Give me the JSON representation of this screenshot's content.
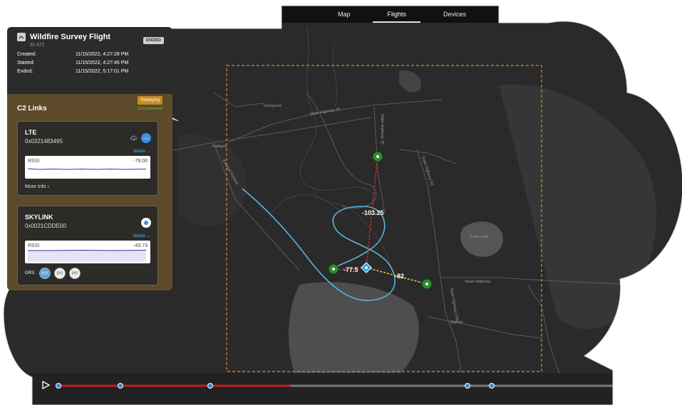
{
  "nav": {
    "tabs": [
      {
        "label": "Map"
      },
      {
        "label": "Flights",
        "active": true
      },
      {
        "label": "Devices"
      }
    ]
  },
  "flight": {
    "title": "Wildfire Survey Flight",
    "id_label": "ID 472",
    "status": "ENDED",
    "created_label": "Created:",
    "created": "11/15/2022, 4:27:28 PM",
    "started_label": "Started:",
    "started": "11/15/2022, 4:27:46 PM",
    "ended_label": "Ended:",
    "ended": "11/15/2022, 5:17:01 PM"
  },
  "c2": {
    "title": "C2 Links",
    "replay_status": "Replaying",
    "gcs_status": "GCS connected",
    "links": [
      {
        "name": "LTE",
        "id": "0x0321483495",
        "badge": "LTE",
        "details": "details",
        "rssi_label": "RSSI",
        "rssi": "-79.00",
        "more_info": "More Info"
      },
      {
        "name": "SKYLINK",
        "id": "0x0021CDDE00",
        "details": "details",
        "rssi_label": "RSSI",
        "rssi": "-43.73",
        "grs_label": "GRS:"
      }
    ]
  },
  "map": {
    "places": [
      {
        "label": "Evergreen"
      },
      {
        "label": "Kalispell"
      },
      {
        "label": "Bigfork"
      },
      {
        "label": "Echo Lake"
      }
    ],
    "roads": [
      {
        "label": "State Highway 35"
      },
      {
        "label": "State Highway 35"
      },
      {
        "label": "State Highway 83"
      },
      {
        "label": "Swan Highway"
      },
      {
        "label": "State Highway 209"
      },
      {
        "label": "Kalispell Bypass"
      }
    ],
    "distances": [
      {
        "label": "-103.25"
      },
      {
        "label": "-77.5"
      },
      {
        "label": "-82"
      }
    ]
  },
  "timeline": {
    "progress": 0.42
  },
  "colors": {
    "panel_bg": "#5c4a2a",
    "map_bg": "#2a2a2a",
    "flight_path": "#5ab6db",
    "red_link": "#d12a2a",
    "yellow_link": "#e6d33a",
    "station": "#2e8b2e",
    "boundary": "#e08a2a",
    "timeline_played": "#c81e1e"
  }
}
